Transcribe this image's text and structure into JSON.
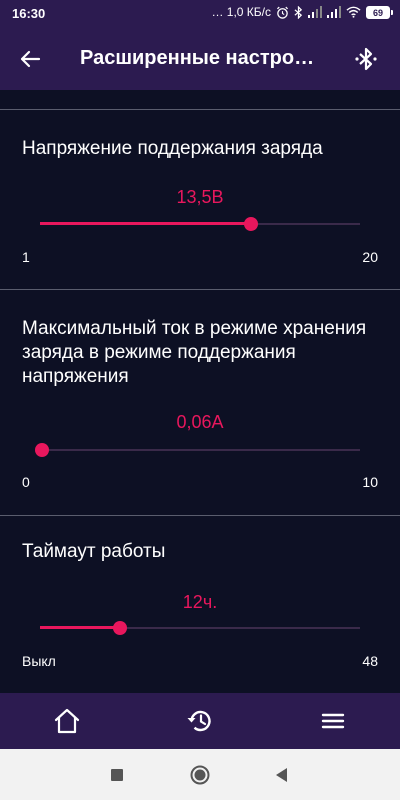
{
  "status_bar": {
    "time": "16:30",
    "network_speed": "… 1,0 КБ/с",
    "battery": "69"
  },
  "app_bar": {
    "title": "Расширенные настро…",
    "back_icon": "arrow-left-icon",
    "action_icon": "bluetooth-icon"
  },
  "settings": [
    {
      "title": "Напряжение поддержания заряда",
      "value_text": "13,5В",
      "min_label": "1",
      "max_label": "20",
      "value": 13.5,
      "min": 1,
      "max": 20
    },
    {
      "title": "Максимальный ток в режиме хранения заряда в режиме поддержания напряжения",
      "value_text": "0,06А",
      "min_label": "0",
      "max_label": "10",
      "value": 0.06,
      "min": 0,
      "max": 10
    },
    {
      "title": "Таймаут работы",
      "value_text": "12ч.",
      "min_label": "Выкл",
      "max_label": "48",
      "value": 12,
      "min": 0,
      "max": 48
    }
  ],
  "bottom_nav": {
    "items": [
      "home-icon",
      "history-icon",
      "menu-icon"
    ]
  },
  "system_nav": {
    "items": [
      "recents-square-icon",
      "home-circle-icon",
      "back-triangle-icon"
    ]
  },
  "colors": {
    "accent": "#e8175d",
    "bar": "#2c1b50",
    "background": "#0d1024"
  }
}
